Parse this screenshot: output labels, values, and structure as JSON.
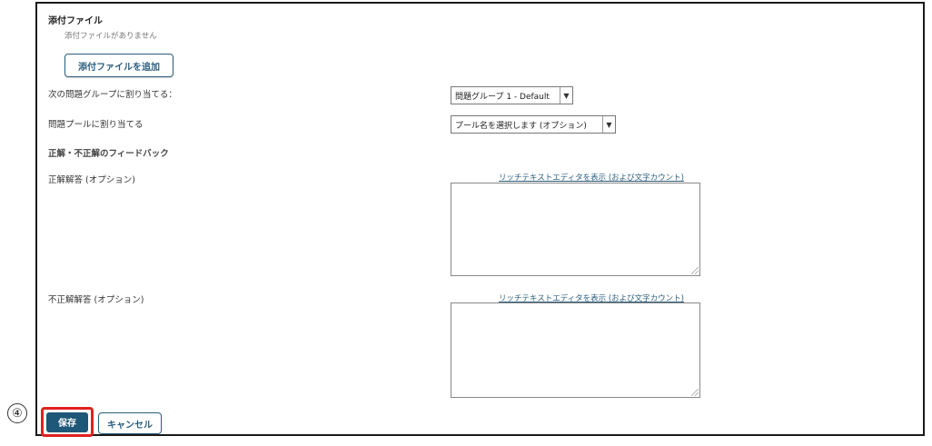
{
  "attachments": {
    "title": "添付ファイル",
    "empty_text": "添付ファイルがありません",
    "add_button": "添付ファイルを追加"
  },
  "group_assign": {
    "label": "次の問題グループに割り当てる：",
    "selected": "問題グループ 1 - Default"
  },
  "pool_assign": {
    "label": "問題プールに割り当てる",
    "selected": "プール名を選択します (オプション)"
  },
  "feedback": {
    "title": "正解・不正解のフィードバック",
    "correct": {
      "label": "正解解答 (オプション)",
      "rte_link": "リッチテキストエディタを表示 (および文字カウント)"
    },
    "incorrect": {
      "label": "不正解解答 (オプション)",
      "rte_link": "リッチテキストエディタを表示 (および文字カウント)"
    }
  },
  "actions": {
    "save": "保存",
    "cancel": "キャンセル"
  },
  "annotation": {
    "step_number": "④",
    "highlight_color": "#e02020"
  },
  "colors": {
    "primary": "#1e5777",
    "link": "#2b5d7d"
  }
}
